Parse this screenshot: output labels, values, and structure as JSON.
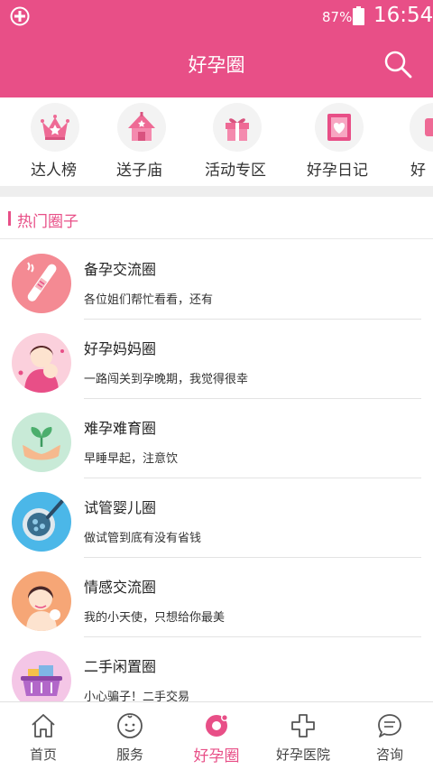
{
  "status_bar": {
    "battery": "87%",
    "time": "16:54"
  },
  "header": {
    "title": "好孕圈"
  },
  "categories": [
    {
      "label": "达人榜",
      "icon": "crown-icon"
    },
    {
      "label": "送子庙",
      "icon": "temple-icon"
    },
    {
      "label": "活动专区",
      "icon": "gift-icon"
    },
    {
      "label": "好孕日记",
      "icon": "diary-icon"
    },
    {
      "label": "好",
      "icon": "partial-icon"
    }
  ],
  "section": {
    "title": "热门圈子"
  },
  "circles": [
    {
      "name": "备孕交流圈",
      "desc": "各位姐们帮忙看看，还有"
    },
    {
      "name": "好孕妈妈圈",
      "desc": "一路闯关到孕晚期，我觉得很幸"
    },
    {
      "name": "难孕难育圈",
      "desc": "早睡早起，注意饮"
    },
    {
      "name": "试管婴儿圈",
      "desc": "做试管到底有没有省钱"
    },
    {
      "name": "情感交流圈",
      "desc": "我的小天使，只想给你最美"
    },
    {
      "name": "二手闲置圈",
      "desc": "小心骗子！二手交易"
    }
  ],
  "nav": [
    {
      "label": "首页",
      "icon": "home-icon",
      "active": false
    },
    {
      "label": "服务",
      "icon": "baby-face-icon",
      "active": false
    },
    {
      "label": "好孕圈",
      "icon": "circle-community-icon",
      "active": true
    },
    {
      "label": "好孕医院",
      "icon": "hospital-cross-icon",
      "active": false
    },
    {
      "label": "咨询",
      "icon": "chat-bubble-icon",
      "active": false
    }
  ],
  "colors": {
    "brand": "#e84f87",
    "divider": "#e3e3e3",
    "text": "#222222"
  }
}
